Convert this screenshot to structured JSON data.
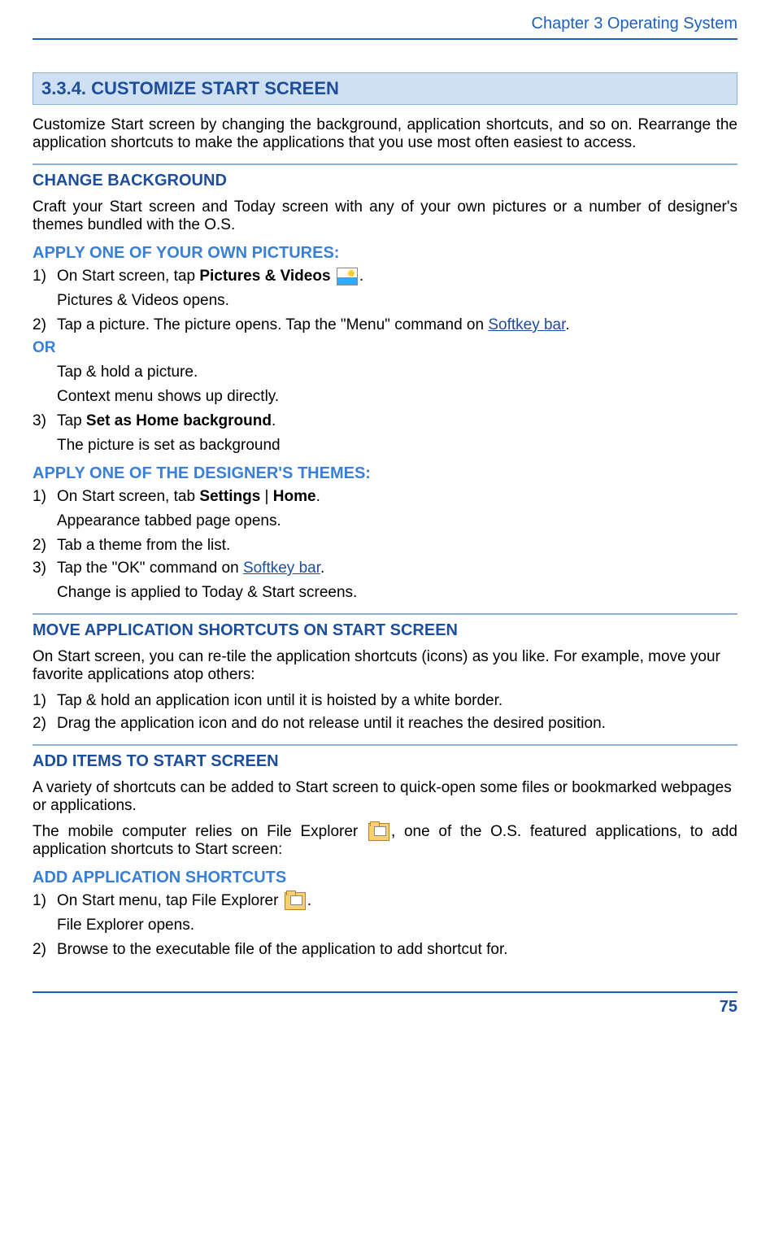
{
  "header": {
    "chapter": "Chapter 3 Operating System"
  },
  "section": {
    "number_title": "3.3.4. CUSTOMIZE START SCREEN",
    "intro": "Customize Start screen by changing the background, application shortcuts, and so on. Rearrange the application shortcuts to make the applications that you use most often easiest to access."
  },
  "change_bg": {
    "title": "CHANGE BACKGROUND",
    "intro": "Craft your Start screen and Today screen with any of your own pictures or a number of designer's themes bundled with the O.S.",
    "own_pictures": {
      "title": "APPLY ONE OF YOUR OWN PICTURES:",
      "step1_pre": "On Start screen, tap ",
      "step1_bold": "Pictures & Videos",
      "step1_post": " ",
      "step1_end": ".",
      "step1_result": "Pictures & Videos opens.",
      "step2_part1": "Tap a picture. The picture opens. Tap the \"Menu\" command on ",
      "step2_link": "Softkey bar",
      "step2_part2": ".",
      "or": "OR",
      "or_line1": "Tap & hold a picture.",
      "or_line2": "Context menu shows up directly.",
      "step3_pre": "Tap ",
      "step3_bold": "Set as Home background",
      "step3_post": ".",
      "step3_result": "The picture is set as background"
    },
    "designer": {
      "title": "APPLY ONE OF THE DESIGNER'S THEMES:",
      "step1_pre": "On Start screen, tab ",
      "step1_bold1": "Settings",
      "step1_sep": " | ",
      "step1_bold2": "Home",
      "step1_post": ".",
      "step1_result": "Appearance tabbed page opens.",
      "step2": "Tab a theme from the list.",
      "step3_pre": "Tap the \"OK\" command on ",
      "step3_link": "Softkey bar",
      "step3_post": ".",
      "step3_result": "Change is applied to Today & Start screens."
    }
  },
  "move_shortcuts": {
    "title": "MOVE APPLICATION SHORTCUTS ON START SCREEN",
    "intro": "On Start screen, you can re-tile the application shortcuts (icons) as you like. For example, move your favorite applications atop others:",
    "step1": "Tap & hold an application icon until it is hoisted by a white border.",
    "step2": "Drag the application icon and do not release until it reaches the desired position."
  },
  "add_items": {
    "title": "ADD ITEMS TO START SCREEN",
    "intro": "A variety of shortcuts can be added to Start screen to quick-open some files or bookmarked webpages or applications.",
    "para2_pre": "The mobile computer relies on File Explorer ",
    "para2_post": ", one of the O.S. featured applications, to add application shortcuts to Start screen:",
    "add_app": {
      "title": "ADD APPLICATION SHORTCUTS",
      "step1_pre": "On Start menu, tap File Explorer ",
      "step1_post": ".",
      "step1_result": "File Explorer opens.",
      "step2": "Browse to the executable file of the application to add shortcut for."
    }
  },
  "footer": {
    "page": "75"
  },
  "nums": {
    "n1": "1)",
    "n2": "2)",
    "n3": "3)"
  }
}
